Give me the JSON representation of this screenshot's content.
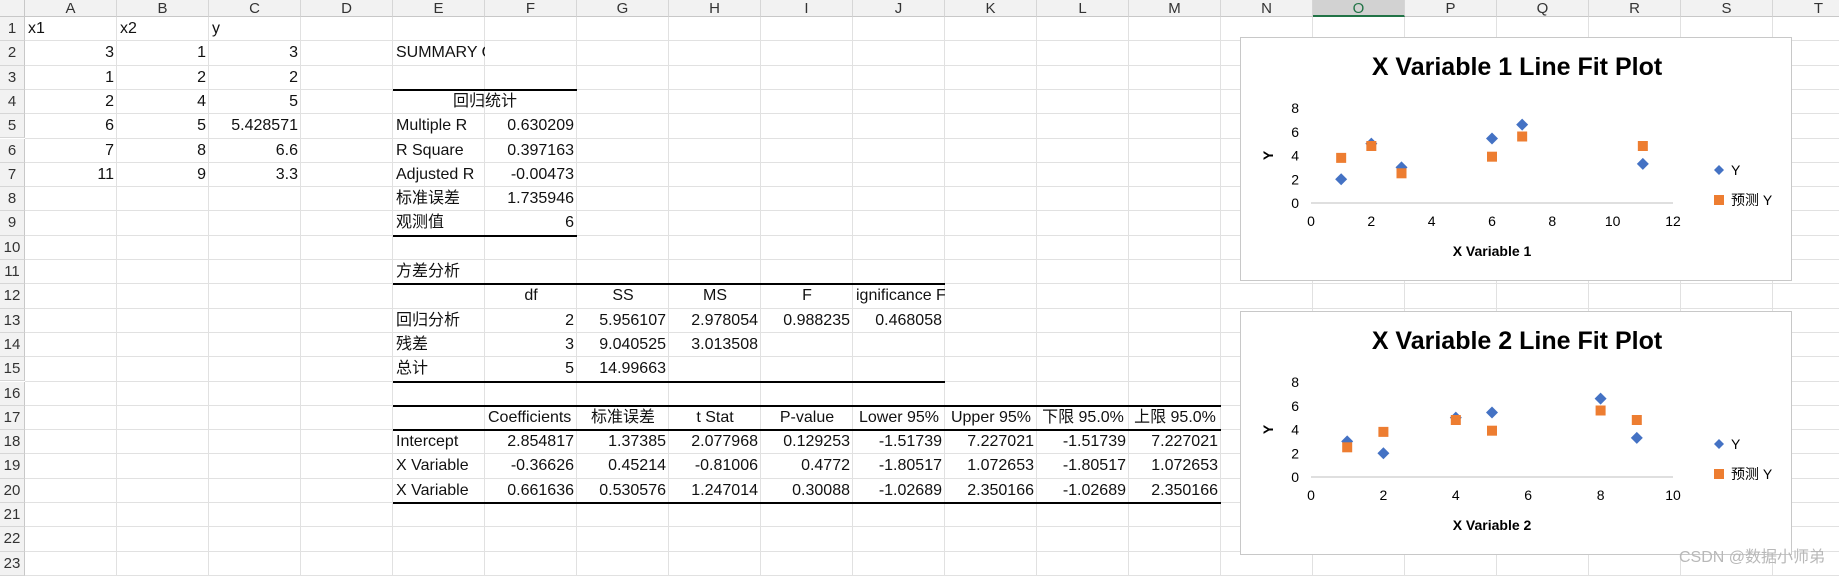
{
  "columns": [
    "A",
    "B",
    "C",
    "D",
    "E",
    "F",
    "G",
    "H",
    "I",
    "J",
    "K",
    "L",
    "M",
    "N",
    "O",
    "P",
    "Q",
    "R",
    "S",
    "T"
  ],
  "selected_column": "O",
  "rows": [
    "1",
    "2",
    "3",
    "4",
    "5",
    "6",
    "7",
    "8",
    "9",
    "10",
    "11",
    "12",
    "13",
    "14",
    "15",
    "16",
    "17",
    "18",
    "19",
    "20",
    "21",
    "22",
    "23"
  ],
  "cells": [
    {
      "ref": "A1",
      "text": "x1",
      "align": "l"
    },
    {
      "ref": "B1",
      "text": "x2",
      "align": "l"
    },
    {
      "ref": "C1",
      "text": "y",
      "align": "l"
    },
    {
      "ref": "A2",
      "text": "3",
      "align": "r"
    },
    {
      "ref": "B2",
      "text": "1",
      "align": "r"
    },
    {
      "ref": "C2",
      "text": "3",
      "align": "r"
    },
    {
      "ref": "A3",
      "text": "1",
      "align": "r"
    },
    {
      "ref": "B3",
      "text": "2",
      "align": "r"
    },
    {
      "ref": "C3",
      "text": "2",
      "align": "r"
    },
    {
      "ref": "A4",
      "text": "2",
      "align": "r"
    },
    {
      "ref": "B4",
      "text": "4",
      "align": "r"
    },
    {
      "ref": "C4",
      "text": "5",
      "align": "r"
    },
    {
      "ref": "A5",
      "text": "6",
      "align": "r"
    },
    {
      "ref": "B5",
      "text": "5",
      "align": "r"
    },
    {
      "ref": "C5",
      "text": "5.428571",
      "align": "r"
    },
    {
      "ref": "A6",
      "text": "7",
      "align": "r"
    },
    {
      "ref": "B6",
      "text": "8",
      "align": "r"
    },
    {
      "ref": "C6",
      "text": "6.6",
      "align": "r"
    },
    {
      "ref": "A7",
      "text": "11",
      "align": "r"
    },
    {
      "ref": "B7",
      "text": "9",
      "align": "r"
    },
    {
      "ref": "C7",
      "text": "3.3",
      "align": "r"
    },
    {
      "ref": "E2",
      "text": "SUMMARY OUTPUT",
      "align": "l"
    },
    {
      "ref": "E4",
      "text": "回归统计",
      "align": "c",
      "span": 2
    },
    {
      "ref": "E5",
      "text": "Multiple R",
      "align": "l"
    },
    {
      "ref": "F5",
      "text": "0.630209",
      "align": "r"
    },
    {
      "ref": "E6",
      "text": "R Square",
      "align": "l"
    },
    {
      "ref": "F6",
      "text": "0.397163",
      "align": "r"
    },
    {
      "ref": "E7",
      "text": "Adjusted R",
      "align": "l"
    },
    {
      "ref": "F7",
      "text": "-0.00473",
      "align": "r"
    },
    {
      "ref": "E8",
      "text": "标准误差",
      "align": "l"
    },
    {
      "ref": "F8",
      "text": "1.735946",
      "align": "r"
    },
    {
      "ref": "E9",
      "text": "观测值",
      "align": "l"
    },
    {
      "ref": "F9",
      "text": "6",
      "align": "r"
    },
    {
      "ref": "E11",
      "text": "方差分析",
      "align": "l"
    },
    {
      "ref": "F12",
      "text": "df",
      "align": "c"
    },
    {
      "ref": "G12",
      "text": "SS",
      "align": "c"
    },
    {
      "ref": "H12",
      "text": "MS",
      "align": "c"
    },
    {
      "ref": "I12",
      "text": "F",
      "align": "c"
    },
    {
      "ref": "J12",
      "text": "ignificance F",
      "align": "l"
    },
    {
      "ref": "E13",
      "text": "回归分析",
      "align": "l"
    },
    {
      "ref": "F13",
      "text": "2",
      "align": "r"
    },
    {
      "ref": "G13",
      "text": "5.956107",
      "align": "r"
    },
    {
      "ref": "H13",
      "text": "2.978054",
      "align": "r"
    },
    {
      "ref": "I13",
      "text": "0.988235",
      "align": "r"
    },
    {
      "ref": "J13",
      "text": "0.468058",
      "align": "r"
    },
    {
      "ref": "E14",
      "text": "残差",
      "align": "l"
    },
    {
      "ref": "F14",
      "text": "3",
      "align": "r"
    },
    {
      "ref": "G14",
      "text": "9.040525",
      "align": "r"
    },
    {
      "ref": "H14",
      "text": "3.013508",
      "align": "r"
    },
    {
      "ref": "E15",
      "text": "总计",
      "align": "l"
    },
    {
      "ref": "F15",
      "text": "5",
      "align": "r"
    },
    {
      "ref": "G15",
      "text": "14.99663",
      "align": "r"
    },
    {
      "ref": "F17",
      "text": "Coefficients",
      "align": "l"
    },
    {
      "ref": "G17",
      "text": "标准误差",
      "align": "c"
    },
    {
      "ref": "H17",
      "text": "t Stat",
      "align": "c"
    },
    {
      "ref": "I17",
      "text": "P-value",
      "align": "c"
    },
    {
      "ref": "J17",
      "text": "Lower 95%",
      "align": "c"
    },
    {
      "ref": "K17",
      "text": "Upper 95%",
      "align": "c"
    },
    {
      "ref": "L17",
      "text": "下限 95.0%",
      "align": "c"
    },
    {
      "ref": "M17",
      "text": "上限 95.0%",
      "align": "c"
    },
    {
      "ref": "E18",
      "text": "Intercept",
      "align": "l"
    },
    {
      "ref": "F18",
      "text": "2.854817",
      "align": "r"
    },
    {
      "ref": "G18",
      "text": "1.37385",
      "align": "r"
    },
    {
      "ref": "H18",
      "text": "2.077968",
      "align": "r"
    },
    {
      "ref": "I18",
      "text": "0.129253",
      "align": "r"
    },
    {
      "ref": "J18",
      "text": "-1.51739",
      "align": "r"
    },
    {
      "ref": "K18",
      "text": "7.227021",
      "align": "r"
    },
    {
      "ref": "L18",
      "text": "-1.51739",
      "align": "r"
    },
    {
      "ref": "M18",
      "text": "7.227021",
      "align": "r"
    },
    {
      "ref": "E19",
      "text": "X Variable",
      "align": "l"
    },
    {
      "ref": "F19",
      "text": "-0.36626",
      "align": "r"
    },
    {
      "ref": "G19",
      "text": "0.45214",
      "align": "r"
    },
    {
      "ref": "H19",
      "text": "-0.81006",
      "align": "r"
    },
    {
      "ref": "I19",
      "text": "0.4772",
      "align": "r"
    },
    {
      "ref": "J19",
      "text": "-1.80517",
      "align": "r"
    },
    {
      "ref": "K19",
      "text": "1.072653",
      "align": "r"
    },
    {
      "ref": "L19",
      "text": "-1.80517",
      "align": "r"
    },
    {
      "ref": "M19",
      "text": "1.072653",
      "align": "r"
    },
    {
      "ref": "E20",
      "text": "X Variable",
      "align": "l"
    },
    {
      "ref": "F20",
      "text": "0.661636",
      "align": "r"
    },
    {
      "ref": "G20",
      "text": "0.530576",
      "align": "r"
    },
    {
      "ref": "H20",
      "text": "1.247014",
      "align": "r"
    },
    {
      "ref": "I20",
      "text": "0.30088",
      "align": "r"
    },
    {
      "ref": "J20",
      "text": "-1.02689",
      "align": "r"
    },
    {
      "ref": "K20",
      "text": "2.350166",
      "align": "r"
    },
    {
      "ref": "L20",
      "text": "-1.02689",
      "align": "r"
    },
    {
      "ref": "M20",
      "text": "2.350166",
      "align": "r"
    }
  ],
  "chart_data": [
    {
      "type": "scatter",
      "title": "X Variable 1 Line Fit  Plot",
      "xlabel": "X Variable 1",
      "ylabel": "Y",
      "xlim": [
        0,
        12
      ],
      "ylim": [
        0,
        8
      ],
      "xticks": [
        "0",
        "2",
        "4",
        "6",
        "8",
        "10",
        "12"
      ],
      "yticks": [
        "0",
        "2",
        "4",
        "6",
        "8"
      ],
      "grid": false,
      "legend_position": "right",
      "series": [
        {
          "name": "Y",
          "marker": "diamond",
          "color": "#4472C4",
          "x": [
            3,
            1,
            2,
            6,
            7,
            11
          ],
          "y": [
            3,
            2,
            5,
            5.428571,
            6.6,
            3.3
          ]
        },
        {
          "name": "预测 Y",
          "marker": "square",
          "color": "#ED7D31",
          "x": [
            3,
            1,
            2,
            6,
            7,
            11
          ],
          "y": [
            2.5,
            3.8,
            4.8,
            3.9,
            5.6,
            4.8
          ]
        }
      ]
    },
    {
      "type": "scatter",
      "title": "X Variable 2 Line Fit  Plot",
      "xlabel": "X Variable 2",
      "ylabel": "Y",
      "xlim": [
        0,
        10
      ],
      "ylim": [
        0,
        8
      ],
      "xticks": [
        "0",
        "2",
        "4",
        "6",
        "8",
        "10"
      ],
      "yticks": [
        "0",
        "2",
        "4",
        "6",
        "8"
      ],
      "grid": false,
      "legend_position": "right",
      "series": [
        {
          "name": "Y",
          "marker": "diamond",
          "color": "#4472C4",
          "x": [
            1,
            2,
            4,
            5,
            8,
            9
          ],
          "y": [
            3,
            2,
            5,
            5.428571,
            6.6,
            3.3
          ]
        },
        {
          "name": "预测 Y",
          "marker": "square",
          "color": "#ED7D31",
          "x": [
            1,
            2,
            4,
            5,
            8,
            9
          ],
          "y": [
            2.5,
            3.8,
            4.8,
            3.9,
            5.6,
            4.8
          ]
        }
      ]
    }
  ],
  "watermark": "CSDN @数据小师弟"
}
